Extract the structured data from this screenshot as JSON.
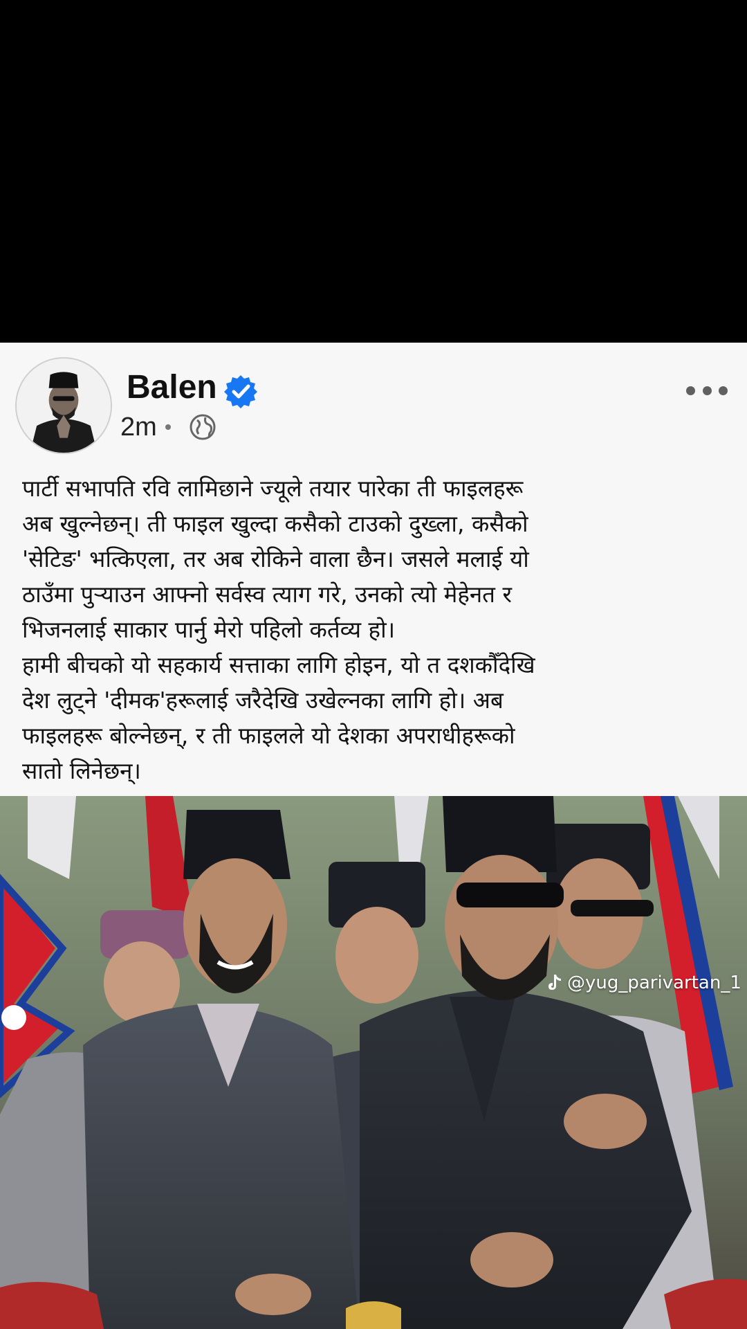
{
  "post": {
    "author_name": "Balen",
    "timestamp": "2m",
    "verified": true,
    "privacy_icon": "globe-icon",
    "more_icon": "more-horizontal-icon",
    "text": "पार्टी सभापति रवि लामिछाने ज्यूले तयार पारेका ती फाइलहरू\nअब खुल्नेछन्। ती फाइल खुल्दा कसैको टाउको दुख्ला, कसैको\n'सेटिङ' भत्किएला, तर अब रोकिने वाला छैन। जसले मलाई यो\nठाउँमा पुऱ्याउन आफ्नो सर्वस्व त्याग गरे, उनको त्यो मेहेनत र\nभिजनलाई साकार पार्नु मेरो पहिलो कर्तव्य हो।\nहामी बीचको यो सहकार्य सत्ताका लागि होइन, यो त दशकौँदेखि\nदेश लुट्ने 'दीमक'हरूलाई जरैदेखि उखेल्नका लागि हो। अब\nफाइलहरू बोल्नेछन्, र ती फाइलले यो देशका अपराधीहरूको\nसातो लिनेछन्।"
  },
  "photo": {
    "watermark": "@yug_parivartan_1",
    "watermark_icon": "tiktok-icon"
  },
  "colors": {
    "background": "#000000",
    "card": "#f7f7f7",
    "verified_blue": "#1877f2",
    "text": "#121212"
  }
}
